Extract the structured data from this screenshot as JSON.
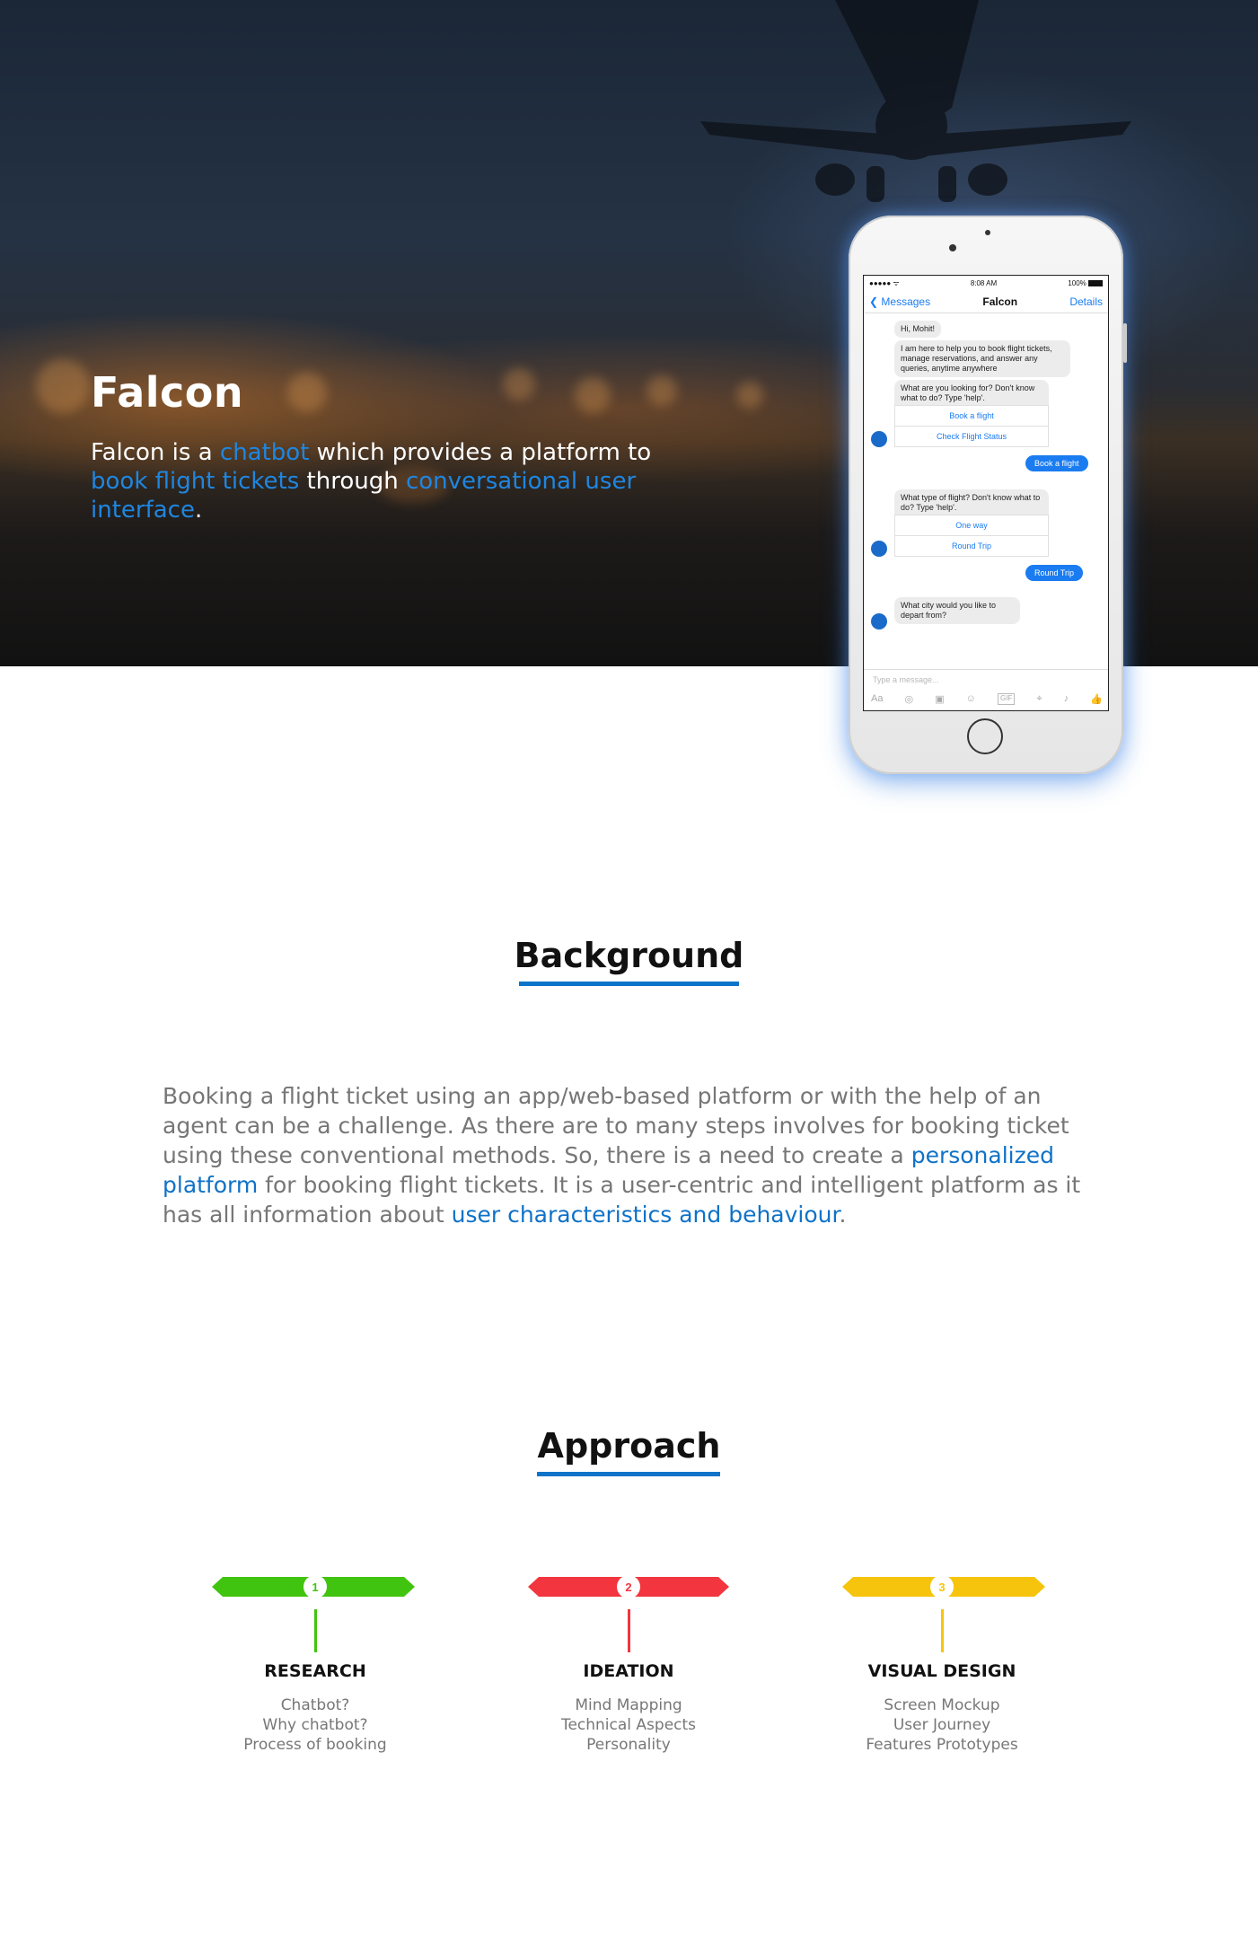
{
  "hero": {
    "title": "Falcon",
    "desc": {
      "p1": "Falcon is a ",
      "h1": "chatbot",
      "p2": " which provides a platform to ",
      "h2": "book flight tickets",
      "p3": " through ",
      "h3": "conversational user interface",
      "p4": "."
    },
    "accent": "#1f86e0"
  },
  "phone": {
    "status": {
      "left": "●●●●● ᯤ",
      "time": "8:08 AM",
      "battery": "100%"
    },
    "nav": {
      "back": "Messages",
      "title": "Falcon",
      "details": "Details"
    },
    "chat": {
      "b1": "Hi, Mohit!",
      "b2": "I am here to help you to book flight tickets, manage reservations, and answer any queries, anytime anywhere",
      "b3": "What are you looking for? Don't know what to do? Type 'help'.",
      "o1": "Book a flight",
      "o2": "Check Flight Status",
      "m1": "Book a flight",
      "b4": "What type of flight? Don't know what to do? Type 'help'.",
      "o3": "One way",
      "o4": "Round Trip",
      "m2": "Round Trip",
      "b5": "What city would you like to depart from?"
    },
    "input": {
      "placeholder": "Type a message...",
      "icons": [
        "Aa",
        "◎",
        "▣",
        "☺",
        "GIF",
        "⌖",
        "♪",
        "👍"
      ]
    }
  },
  "background": {
    "title": "Background",
    "text": {
      "p1": "Booking a flight ticket using an app/web-based platform or with the help of an agent can be a challenge. As there are to many steps involves for booking ticket using these conventional methods. So, there is a need to create a ",
      "h1": "personalized platform",
      "p2": " for booking flight tickets. It is a user-centric and intelligent platform as it has all information about ",
      "h2": "user characteristics and behaviour",
      "p3": "."
    }
  },
  "approach": {
    "title": "Approach",
    "steps": [
      {
        "num": "1",
        "title": "RESEARCH",
        "color": "#41c40f",
        "items": [
          "Chatbot?",
          "Why chatbot?",
          "Process of booking"
        ]
      },
      {
        "num": "2",
        "title": "IDEATION",
        "color": "#f2353e",
        "items": [
          "Mind Mapping",
          "Technical Aspects",
          "Personality"
        ]
      },
      {
        "num": "3",
        "title": "VISUAL DESIGN",
        "color": "#f6c40c",
        "items": [
          "Screen Mockup",
          "User Journey",
          "Features Prototypes"
        ]
      }
    ]
  }
}
